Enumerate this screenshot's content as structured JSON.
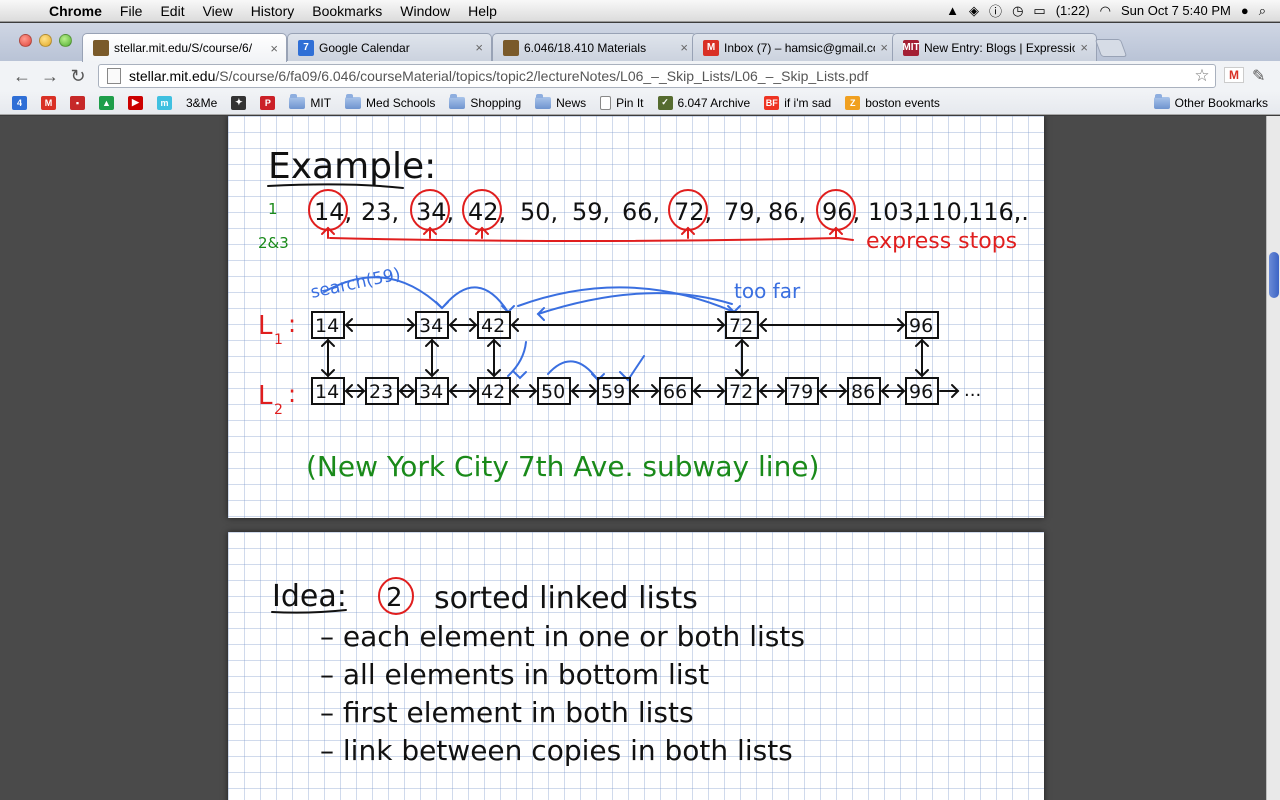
{
  "menubar": {
    "app": "Chrome",
    "items": [
      "File",
      "Edit",
      "View",
      "History",
      "Bookmarks",
      "Window",
      "Help"
    ],
    "battery": "(1:22)",
    "clock": "Sun Oct 7  5:40 PM"
  },
  "tabs": [
    {
      "title": "stellar.mit.edu/S/course/6/",
      "active": true,
      "fav_color": "#7a5a2a",
      "fav_text": ""
    },
    {
      "title": "Google Calendar",
      "active": false,
      "fav_color": "#2f6fd6",
      "fav_text": "7"
    },
    {
      "title": "6.046/18.410 Materials",
      "active": false,
      "fav_color": "#7a5a2a",
      "fav_text": ""
    },
    {
      "title": "Inbox (7) – hamsic@gmail.co",
      "active": false,
      "fav_color": "#d93025",
      "fav_text": "M"
    },
    {
      "title": "New Entry: Blogs | Expressio",
      "active": false,
      "fav_color": "#a31f34",
      "fav_text": "MIT"
    }
  ],
  "toolbar": {
    "url_host": "stellar.mit.edu",
    "url_path": "/S/course/6/fa09/6.046/courseMaterial/topics/topic2/lectureNotes/L06_–_Skip_Lists/L06_–_Skip_Lists.pdf"
  },
  "bookmarks": [
    {
      "label": "",
      "icon": "4",
      "color": "#2f6fd6"
    },
    {
      "label": "",
      "icon": "M",
      "color": "#d93025"
    },
    {
      "label": "",
      "icon": "▪",
      "color": "#c62828"
    },
    {
      "label": "",
      "icon": "▲",
      "color": "#1e9e4a"
    },
    {
      "label": "",
      "icon": "▶",
      "color": "#cc0000"
    },
    {
      "label": "",
      "icon": "m",
      "color": "#3fc0e0"
    },
    {
      "label": "3&Me",
      "icon": "",
      "color": ""
    },
    {
      "label": "",
      "icon": "✦",
      "color": "#333"
    },
    {
      "label": "",
      "icon": "P",
      "color": "#cb2027"
    },
    {
      "label": "MIT",
      "icon": "folder",
      "color": ""
    },
    {
      "label": "Med Schools",
      "icon": "folder",
      "color": ""
    },
    {
      "label": "Shopping",
      "icon": "folder",
      "color": ""
    },
    {
      "label": "News",
      "icon": "folder",
      "color": ""
    },
    {
      "label": "Pin It",
      "icon": "doc",
      "color": ""
    },
    {
      "label": "6.047 Archive",
      "icon": "✓",
      "color": "#556b2f"
    },
    {
      "label": "if i'm sad",
      "icon": "BF",
      "color": "#ee3322"
    },
    {
      "label": "boston events",
      "icon": "Z",
      "color": "#f0a020"
    }
  ],
  "other_bookmarks": "Other Bookmarks",
  "notes": {
    "page1": {
      "heading": "Example:",
      "row1_label": "1",
      "row23_label": "2&3",
      "sequence": [
        "14",
        "23",
        "34",
        "42",
        "50",
        "59",
        "66",
        "72",
        "79",
        "86",
        "96",
        "103",
        "110",
        "116",
        "..."
      ],
      "express_circled": [
        "14",
        "34",
        "42",
        "72",
        "96"
      ],
      "express_label": "express stops",
      "search_label": "search(59)",
      "too_far_label": "too far",
      "l1_label": "L",
      "l1_sub": "1",
      "l2_label": "L",
      "l2_sub": "2",
      "l1_nodes": [
        "14",
        "34",
        "42",
        "72",
        "96"
      ],
      "l2_nodes": [
        "14",
        "23",
        "34",
        "42",
        "50",
        "59",
        "66",
        "72",
        "79",
        "86",
        "96"
      ],
      "l2_tail": "...",
      "caption": "(New York City 7th Ave. subway line)"
    },
    "page2": {
      "idea_label": "Idea:",
      "idea_number": "2",
      "idea_rest": "sorted linked lists",
      "bullets": [
        "– each element in one or both lists",
        "– all elements in bottom list",
        "– first element in both lists",
        "– link between copies in both lists"
      ]
    }
  },
  "colors": {
    "ink": "#111111",
    "red": "#e01e1e",
    "green": "#1a8a1a",
    "blue": "#3a6fe0"
  }
}
